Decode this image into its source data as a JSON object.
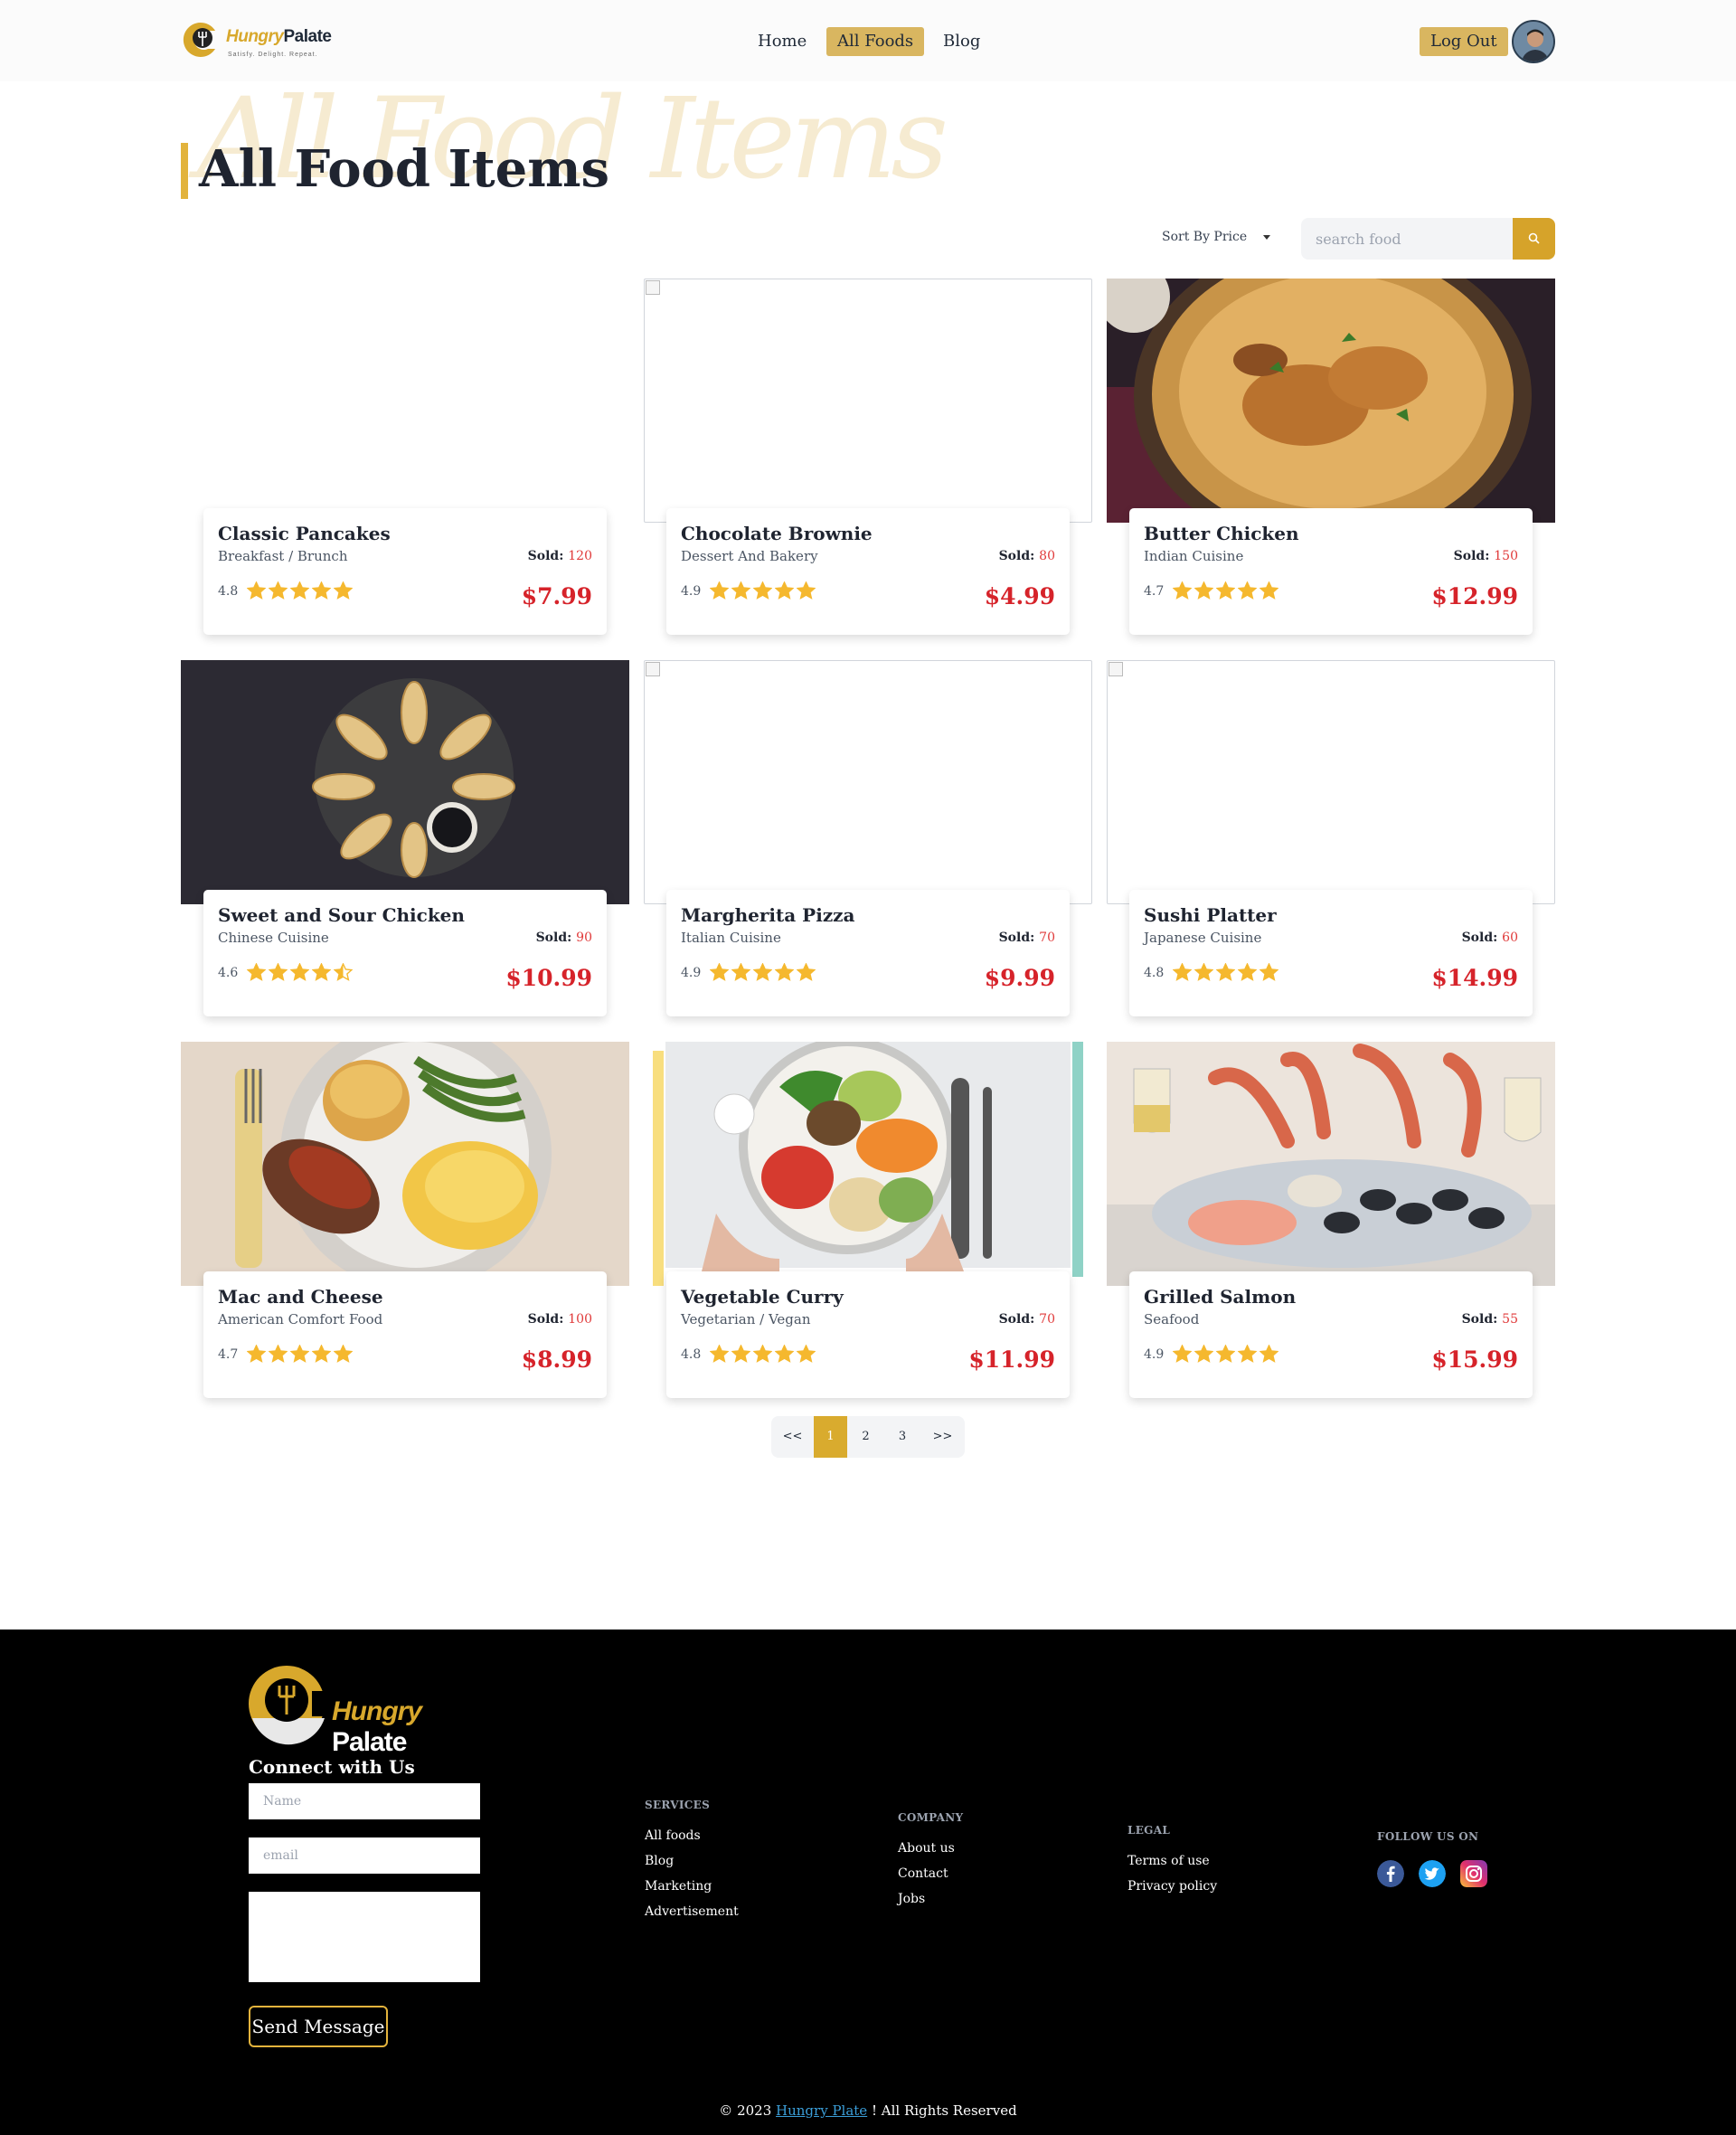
{
  "nav": {
    "brand_a": "Hungry",
    "brand_b": "Palate",
    "tagline": "Satisfy. Delight. Repeat.",
    "links": [
      "Home",
      "All Foods",
      "Blog"
    ],
    "logout": "Log Out"
  },
  "page": {
    "bg_title": "All Food Items",
    "title": "All Food Items",
    "sort_label": "Sort By Price",
    "search_placeholder": "search food"
  },
  "foods": [
    {
      "name": "Classic Pancakes",
      "category": "Breakfast / Brunch",
      "sold_label": "Sold:",
      "sold": "120",
      "rating": "4.8",
      "price": "$7.99"
    },
    {
      "name": "Chocolate Brownie",
      "category": "Dessert And Bakery",
      "sold_label": "Sold:",
      "sold": "80",
      "rating": "4.9",
      "price": "$4.99"
    },
    {
      "name": "Butter Chicken",
      "category": "Indian Cuisine",
      "sold_label": "Sold:",
      "sold": "150",
      "rating": "4.7",
      "price": "$12.99"
    },
    {
      "name": "Sweet and Sour Chicken",
      "category": "Chinese Cuisine",
      "sold_label": "Sold:",
      "sold": "90",
      "rating": "4.6",
      "price": "$10.99"
    },
    {
      "name": "Margherita Pizza",
      "category": "Italian Cuisine",
      "sold_label": "Sold:",
      "sold": "70",
      "rating": "4.9",
      "price": "$9.99"
    },
    {
      "name": "Sushi Platter",
      "category": "Japanese Cuisine",
      "sold_label": "Sold:",
      "sold": "60",
      "rating": "4.8",
      "price": "$14.99"
    },
    {
      "name": "Mac and Cheese",
      "category": "American Comfort Food",
      "sold_label": "Sold:",
      "sold": "100",
      "rating": "4.7",
      "price": "$8.99"
    },
    {
      "name": "Vegetable Curry",
      "category": "Vegetarian / Vegan",
      "sold_label": "Sold:",
      "sold": "70",
      "rating": "4.8",
      "price": "$11.99"
    },
    {
      "name": "Grilled Salmon",
      "category": "Seafood",
      "sold_label": "Sold:",
      "sold": "55",
      "rating": "4.9",
      "price": "$15.99"
    }
  ],
  "pagination": [
    "<<",
    "1",
    "2",
    "3",
    ">>"
  ],
  "footer": {
    "brand_a": "Hungry",
    "brand_b": "Palate",
    "connect": "Connect with Us",
    "name_placeholder": "Name",
    "email_placeholder": "email",
    "send": "Send Message",
    "services_head": "SERVICES",
    "services": [
      "All foods",
      "Blog",
      "Marketing",
      "Advertisement"
    ],
    "company_head": "COMPANY",
    "company": [
      "About us",
      "Contact",
      "Jobs"
    ],
    "legal_head": "LEGAL",
    "legal": [
      "Terms of use",
      "Privacy policy"
    ],
    "follow_head": "FOLLOW US ON",
    "copy_pre": "© 2023",
    "copy_link": "Hungry Plate",
    "copy_post": "! All Rights Reserved"
  },
  "colors": {
    "accent": "#d9b660",
    "price": "#d6232a",
    "star": "#f5b82e"
  },
  "icons": [
    "search-icon",
    "star-icon",
    "facebook-icon",
    "twitter-icon",
    "instagram-icon"
  ]
}
